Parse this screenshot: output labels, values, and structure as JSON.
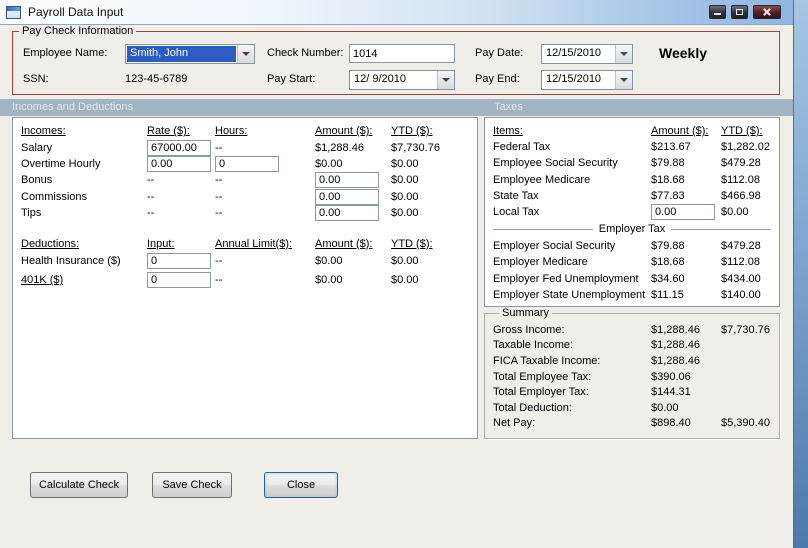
{
  "window": {
    "title": "Payroll Data Input"
  },
  "icons": {
    "app-icon": "form-window",
    "minimize-icon": "bar",
    "maximize-icon": "square",
    "close-icon": "x",
    "dropdown-icon": "down-arrow-triangle"
  },
  "colors": {
    "form_bg": "#EFEEE8",
    "section_bar": "#A2B3C1",
    "section_text": "#E3E9EE",
    "group_border": "#AC3B39",
    "selection_bg": "#2C5CC5",
    "selection_text": "#FFFFFF",
    "panel_border": "#8E98A3",
    "desktop_top": "#A6C6E5",
    "desktop_bottom": "#4C79AB"
  },
  "paycheck_info": {
    "group_label": "Pay Check Information",
    "employee_name_label": "Employee Name:",
    "employee_name_value": "Smith, John",
    "ssn_label": "SSN:",
    "ssn_value": "123-45-6789",
    "check_number_label": "Check Number:",
    "check_number_value": "1014",
    "pay_start_label": "Pay Start:",
    "pay_start_value": "12/ 9/2010",
    "pay_date_label": "Pay Date:",
    "pay_date_value": "12/15/2010",
    "pay_end_label": "Pay End:",
    "pay_end_value": "12/15/2010",
    "frequency": "Weekly"
  },
  "sections": {
    "incomes_deductions": "Incomes and Deductions",
    "taxes": "Taxes"
  },
  "incomes": {
    "headers": {
      "name": "Incomes:",
      "rate": "Rate ($):",
      "hours": "Hours:",
      "amount": "Amount ($):",
      "ytd": "YTD ($):"
    },
    "rows": [
      {
        "name": "Salary",
        "rate_input": "67000.00",
        "hours_text": "--",
        "amount": "$1,288.46",
        "ytd": "$7,730.76"
      },
      {
        "name": "Overtime Hourly",
        "rate_input": "0.00",
        "hours_input": "0",
        "amount": "$0.00",
        "ytd": "$0.00"
      },
      {
        "name": "Bonus",
        "rate_text": "--",
        "hours_text": "--",
        "amount_input": "0.00",
        "ytd": "$0.00"
      },
      {
        "name": "Commissions",
        "rate_text": "--",
        "hours_text": "--",
        "amount_input": "0.00",
        "ytd": "$0.00"
      },
      {
        "name": "Tips",
        "rate_text": "--",
        "hours_text": "--",
        "amount_input": "0.00",
        "ytd": "$0.00"
      }
    ]
  },
  "deductions": {
    "headers": {
      "name": "Deductions:",
      "input": "Input:",
      "limit": "Annual Limit($):",
      "amount": "Amount ($):",
      "ytd": "YTD ($):"
    },
    "rows": [
      {
        "name": "Health Insurance  ($)",
        "input_value": "0",
        "limit": "--",
        "amount": "$0.00",
        "ytd": "$0.00"
      },
      {
        "name": "401K  ($)",
        "input_value": "0",
        "limit": "--",
        "amount": "$0.00",
        "ytd": "$0.00"
      }
    ]
  },
  "taxes": {
    "headers": {
      "item": "Items:",
      "amount": "Amount ($):",
      "ytd": "YTD ($):"
    },
    "employee_rows": [
      {
        "item": "Federal Tax",
        "amount": "$213.67",
        "ytd": "$1,282.02"
      },
      {
        "item": "Employee Social Security",
        "amount": "$79.88",
        "ytd": "$479.28"
      },
      {
        "item": "Employee Medicare",
        "amount": "$18.68",
        "ytd": "$112.08"
      },
      {
        "item": "State Tax",
        "amount": "$77.83",
        "ytd": "$466.98"
      },
      {
        "item": "Local Tax",
        "amount_input": "0.00",
        "ytd": "$0.00"
      }
    ],
    "separator_label": "Employer Tax",
    "employer_rows": [
      {
        "item": "Employer Social Security",
        "amount": "$79.88",
        "ytd": "$479.28"
      },
      {
        "item": "Employer Medicare",
        "amount": "$18.68",
        "ytd": "$112.08"
      },
      {
        "item": "Employer Fed Unemployment",
        "amount": "$34.60",
        "ytd": "$434.00"
      },
      {
        "item": "Employer State Unemployment",
        "amount": "$11.15",
        "ytd": "$140.00"
      }
    ]
  },
  "summary": {
    "group_label": "Summary",
    "rows": [
      {
        "label": "Gross Income:",
        "amount": "$1,288.46",
        "ytd": "$7,730.76"
      },
      {
        "label": "Taxable Income:",
        "amount": "$1,288.46",
        "ytd": ""
      },
      {
        "label": "FICA Taxable Income:",
        "amount": "$1,288.46",
        "ytd": ""
      },
      {
        "label": "Total Employee Tax:",
        "amount": "$390.06",
        "ytd": ""
      },
      {
        "label": "Total Employer Tax:",
        "amount": "$144.31",
        "ytd": ""
      },
      {
        "label": "Total Deduction:",
        "amount": "$0.00",
        "ytd": ""
      },
      {
        "label": "Net Pay:",
        "amount": "$898.40",
        "ytd": "$5,390.40"
      }
    ]
  },
  "buttons": {
    "calculate": "Calculate Check",
    "save": "Save Check",
    "close": "Close"
  }
}
